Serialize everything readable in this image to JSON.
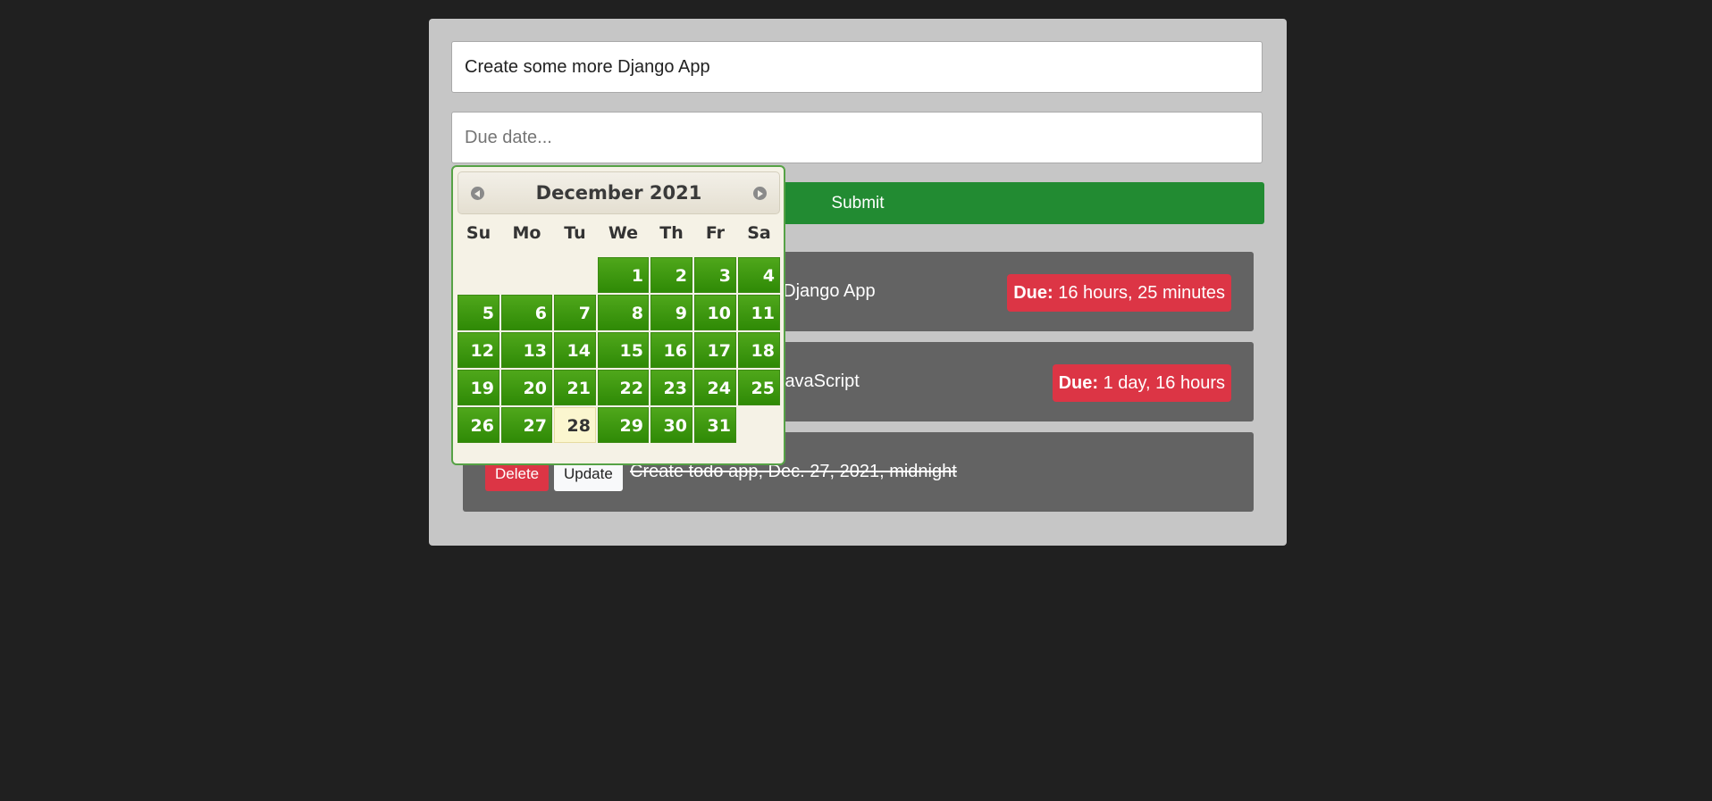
{
  "form": {
    "title_value": "Create some more Django App",
    "due_placeholder": "Due date...",
    "submit_label": "Submit"
  },
  "todos": [
    {
      "text": "Create some more Django App",
      "due_label": "Due:",
      "due_value": "16 hours, 25 minutes"
    },
    {
      "text": "Learn more about JavaScript",
      "due_label": "Due:",
      "due_value": "1 day, 16 hours"
    },
    {
      "text": "Create todo app, Dec. 27, 2021, midnight",
      "delete_label": "Delete",
      "update_label": "Update"
    }
  ],
  "datepicker": {
    "month_title": "December 2021",
    "weekdays": [
      "Su",
      "Mo",
      "Tu",
      "We",
      "Th",
      "Fr",
      "Sa"
    ],
    "weeks": [
      [
        "",
        "",
        "",
        "1",
        "2",
        "3",
        "4"
      ],
      [
        "5",
        "6",
        "7",
        "8",
        "9",
        "10",
        "11"
      ],
      [
        "12",
        "13",
        "14",
        "15",
        "16",
        "17",
        "18"
      ],
      [
        "19",
        "20",
        "21",
        "22",
        "23",
        "24",
        "25"
      ],
      [
        "26",
        "27",
        "28",
        "29",
        "30",
        "31",
        ""
      ]
    ],
    "highlighted_day": "28"
  },
  "colors": {
    "page_bg": "#202020",
    "panel_bg": "#c6c6c6",
    "submit_green": "#228b32",
    "badge_red": "#dc3545",
    "day_green": "#3c9a10",
    "today_bg": "#fbf6cf"
  }
}
